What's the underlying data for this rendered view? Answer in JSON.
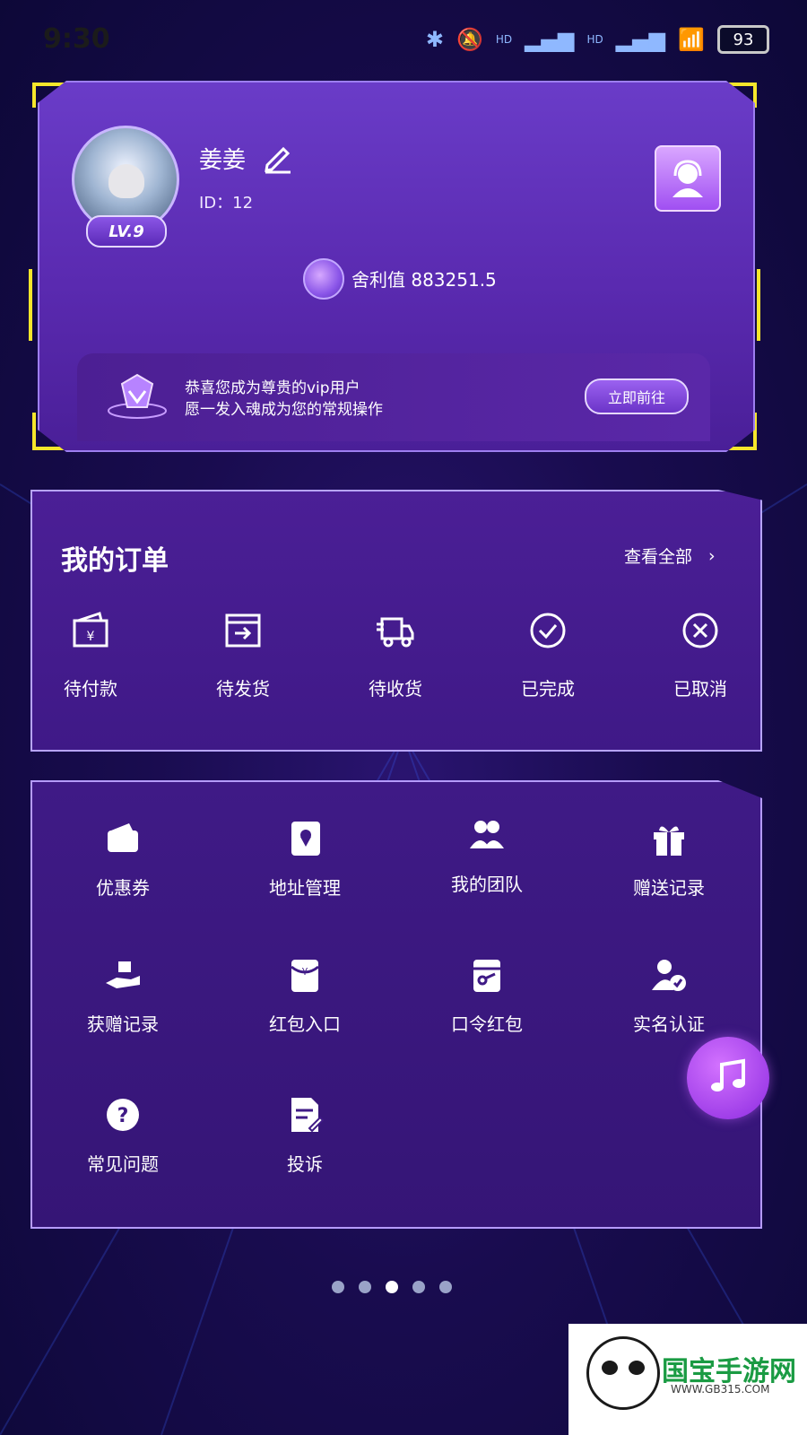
{
  "status_bar": {
    "time": "9:30",
    "battery": "93",
    "network_labels": [
      "HD",
      "HD"
    ]
  },
  "profile": {
    "username": "姜姜",
    "user_id": "ID：12",
    "level": "LV.9",
    "points_text": "舍利值 883251.5",
    "vip_line1": "恭喜您成为尊贵的vip用户",
    "vip_line2": "愿一发入魂成为您的常规操作",
    "vip_button": "立即前往"
  },
  "orders": {
    "title": "我的订单",
    "view_all": "查看全部",
    "items": [
      {
        "label": "待付款",
        "icon": "wallet-yen-icon"
      },
      {
        "label": "待发货",
        "icon": "box-out-icon"
      },
      {
        "label": "待收货",
        "icon": "truck-icon"
      },
      {
        "label": "已完成",
        "icon": "check-circle-icon"
      },
      {
        "label": "已取消",
        "icon": "x-circle-icon"
      }
    ]
  },
  "tools": {
    "items": [
      {
        "label": "优惠券",
        "icon": "coupon-icon"
      },
      {
        "label": "地址管理",
        "icon": "address-book-icon"
      },
      {
        "label": "我的团队",
        "icon": "team-icon"
      },
      {
        "label": "赠送记录",
        "icon": "gift-icon"
      },
      {
        "label": "获赠记录",
        "icon": "hand-gift-icon"
      },
      {
        "label": "红包入口",
        "icon": "red-envelope-icon"
      },
      {
        "label": "口令红包",
        "icon": "key-envelope-icon"
      },
      {
        "label": "实名认证",
        "icon": "verify-user-icon"
      },
      {
        "label": "常见问题",
        "icon": "question-icon"
      },
      {
        "label": "投诉",
        "icon": "complaint-icon"
      }
    ]
  },
  "pagination": {
    "count": 5,
    "active_index": 2
  },
  "watermark": {
    "brand": "国宝手游网",
    "url": "WWW.GB315.COM"
  },
  "colors": {
    "card_purple": "#5a2ab0",
    "accent_yellow": "#f5e62b",
    "fab_pink": "#c35bff"
  }
}
